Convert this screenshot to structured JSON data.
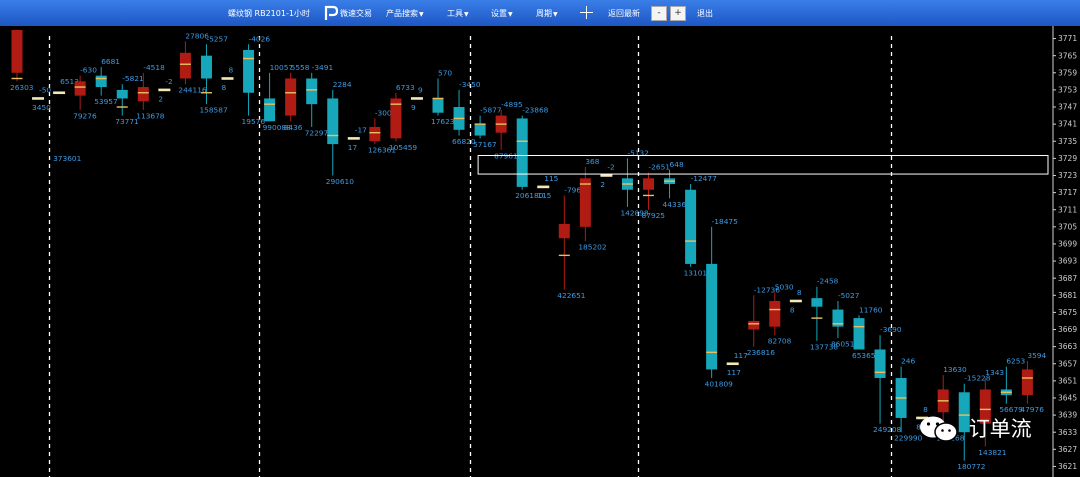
{
  "toolbar": {
    "title": "螺纹钢 RB2101-1小时",
    "brand": "微速交易",
    "menus": [
      {
        "label": "产品搜索",
        "has_caret": true
      },
      {
        "label": "工具",
        "has_caret": true
      },
      {
        "label": "设置",
        "has_caret": true
      },
      {
        "label": "周期",
        "has_caret": true
      }
    ],
    "reset_label": "返回最新",
    "zoom_out": "-",
    "zoom_in": "+",
    "exit_label": "退出"
  },
  "watermark": {
    "text": "订单流"
  },
  "colors": {
    "up": "#b01c14",
    "down": "#16a7bb",
    "doji": "#f2e9b6",
    "label": "#3c9be6",
    "poc": "#e8c060",
    "grid": "#ffffff"
  },
  "chart_data": {
    "type": "candlestick",
    "instrument": "RB2101",
    "period": "1小时",
    "ylim": [
      3618,
      3774
    ],
    "y_ticks": [
      "3771",
      "3765",
      "3759",
      "3753",
      "3747",
      "3741",
      "3735",
      "3729",
      "3723",
      "3717",
      "3711",
      "3705",
      "3699",
      "3693",
      "3687",
      "3681",
      "3675",
      "3669",
      "3663",
      "3657",
      "3651",
      "3645",
      "3639",
      "3633",
      "3627",
      "3621"
    ],
    "session_separators_after_index": [
      1,
      11,
      21,
      29,
      41,
      51,
      59
    ],
    "highlight_band": {
      "from_index": 22,
      "to_index": 63,
      "y_low": 3723.5,
      "y_high": 3730
    },
    "volume_profile_bar": {
      "from_index": 62,
      "y_low": 3646,
      "y_high": 3650
    },
    "candles": [
      {
        "o": 3759,
        "h": 3774,
        "l": 3756,
        "c": 3774,
        "poc": 3757,
        "top": "",
        "bot": "26303"
      },
      {
        "o": 3750,
        "h": 3751,
        "l": 3749,
        "c": 3750,
        "top": "-50",
        "bot": "3450"
      },
      {
        "o": 3752,
        "h": 3754,
        "l": 3731,
        "c": 3752,
        "poc": 3743,
        "top": "6513",
        "bot": "373601"
      },
      {
        "o": 3751,
        "h": 3758,
        "l": 3746,
        "c": 3756,
        "poc": 3754,
        "top": "-630",
        "bot": "79276"
      },
      {
        "o": 3758,
        "h": 3761,
        "l": 3751,
        "c": 3754,
        "poc": 3757,
        "top": "6681",
        "bot": "53957"
      },
      {
        "o": 3753,
        "h": 3755,
        "l": 3744,
        "c": 3750,
        "poc": 3747,
        "top": "-5821",
        "bot": "73771"
      },
      {
        "o": 3749,
        "h": 3759,
        "l": 3746,
        "c": 3754,
        "poc": 3752,
        "top": "-4518",
        "bot": "113678"
      },
      {
        "o": 3753,
        "h": 3754,
        "l": 3752,
        "c": 3753,
        "top": "-2",
        "bot": "2"
      },
      {
        "o": 3757,
        "h": 3770,
        "l": 3755,
        "c": 3766,
        "poc": 3762,
        "top": "27806",
        "bot": "244116"
      },
      {
        "o": 3765,
        "h": 3769,
        "l": 3748,
        "c": 3757,
        "poc": 3752,
        "top": "-5257",
        "bot": "158587"
      },
      {
        "o": 3757,
        "h": 3758,
        "l": 3756,
        "c": 3757,
        "top": "8",
        "bot": "8"
      },
      {
        "o": 3767,
        "h": 3769,
        "l": 3744,
        "c": 3752,
        "poc": 3764,
        "top": "-4026",
        "bot": "19576"
      },
      {
        "o": 3750,
        "h": 3759,
        "l": 3742,
        "c": 3742,
        "poc": 3748,
        "top": "10057",
        "bot": "990088"
      },
      {
        "o": 3744,
        "h": 3759,
        "l": 3742,
        "c": 3757,
        "poc": 3752,
        "top": "5558",
        "bot": "8436"
      },
      {
        "o": 3757,
        "h": 3759,
        "l": 3740,
        "c": 3748,
        "poc": 3753,
        "top": "-3491",
        "bot": "72297"
      },
      {
        "o": 3750,
        "h": 3753,
        "l": 3723,
        "c": 3734,
        "poc": 3737,
        "top": "2284",
        "bot": "290610"
      },
      {
        "o": 3736,
        "h": 3737,
        "l": 3735,
        "c": 3736,
        "top": "-17",
        "bot": "17"
      },
      {
        "o": 3735,
        "h": 3743,
        "l": 3734,
        "c": 3740,
        "poc": 3738,
        "top": "-3005",
        "bot": "126361"
      },
      {
        "o": 3736,
        "h": 3752,
        "l": 3735,
        "c": 3750,
        "poc": 3748,
        "top": "6733",
        "bot": "105459"
      },
      {
        "o": 3750,
        "h": 3751,
        "l": 3749,
        "c": 3750,
        "top": "9",
        "bot": "9"
      },
      {
        "o": 3750,
        "h": 3757,
        "l": 3744,
        "c": 3745,
        "poc": 3750,
        "top": "570",
        "bot": "17623"
      },
      {
        "o": 3747,
        "h": 3753,
        "l": 3737,
        "c": 3739,
        "poc": 3743,
        "top": "-3450",
        "bot": "66820"
      },
      {
        "o": 3741,
        "h": 3744,
        "l": 3736,
        "c": 3737,
        "poc": 3741,
        "top": "-5877",
        "bot": "57167"
      },
      {
        "o": 3738,
        "h": 3746,
        "l": 3732,
        "c": 3744,
        "poc": 3741,
        "top": "-4895",
        "bot": "87961"
      },
      {
        "o": 3743,
        "h": 3744,
        "l": 3718,
        "c": 3719,
        "poc": 3735,
        "top": "-23868",
        "bot": "206180"
      },
      {
        "o": 3719,
        "h": 3720,
        "l": 3718,
        "c": 3719,
        "top": "115",
        "bot": "115"
      },
      {
        "o": 3701,
        "h": 3716,
        "l": 3683,
        "c": 3706,
        "poc": 3695,
        "top": "-7963",
        "bot": "422651"
      },
      {
        "o": 3705,
        "h": 3726,
        "l": 3700,
        "c": 3722,
        "poc": 3720,
        "top": "368",
        "bot": "185202"
      },
      {
        "o": 3723,
        "h": 3724,
        "l": 3722,
        "c": 3723,
        "top": "-2",
        "bot": "2"
      },
      {
        "o": 3722,
        "h": 3729,
        "l": 3712,
        "c": 3718,
        "poc": 3720,
        "top": "-5132",
        "bot": "142898"
      },
      {
        "o": 3718,
        "h": 3724,
        "l": 3711,
        "c": 3722,
        "poc": 3716,
        "top": "-2651",
        "bot": "87925"
      },
      {
        "o": 3722,
        "h": 3725,
        "l": 3715,
        "c": 3720,
        "poc": 3721,
        "top": "648",
        "bot": "44336"
      },
      {
        "o": 3718,
        "h": 3720,
        "l": 3691,
        "c": 3692,
        "poc": 3700,
        "top": "-12477",
        "bot": "131013"
      },
      {
        "o": 3692,
        "h": 3705,
        "l": 3652,
        "c": 3655,
        "poc": 3661,
        "top": "-18475",
        "bot": "401809"
      },
      {
        "o": 3657,
        "h": 3658,
        "l": 3656,
        "c": 3657,
        "top": "117",
        "bot": "117"
      },
      {
        "o": 3669,
        "h": 3681,
        "l": 3663,
        "c": 3672,
        "poc": 3671,
        "top": "-12736",
        "bot": "236816"
      },
      {
        "o": 3670,
        "h": 3682,
        "l": 3667,
        "c": 3679,
        "poc": 3676,
        "top": "5030",
        "bot": "82708"
      },
      {
        "o": 3679,
        "h": 3680,
        "l": 3678,
        "c": 3679,
        "top": "8",
        "bot": "8"
      },
      {
        "o": 3680,
        "h": 3684,
        "l": 3665,
        "c": 3677,
        "poc": 3673,
        "top": "-2458",
        "bot": "137738"
      },
      {
        "o": 3676,
        "h": 3679,
        "l": 3666,
        "c": 3670,
        "poc": 3671,
        "top": "-5027",
        "bot": "86051"
      },
      {
        "o": 3673,
        "h": 3674,
        "l": 3662,
        "c": 3662,
        "poc": 3670,
        "top": "11760",
        "bot": "65365"
      },
      {
        "o": 3662,
        "h": 3667,
        "l": 3636,
        "c": 3652,
        "poc": 3654,
        "top": "-3690",
        "bot": "249208"
      },
      {
        "o": 3652,
        "h": 3656,
        "l": 3633,
        "c": 3638,
        "poc": 3645,
        "top": "246",
        "bot": "229990"
      },
      {
        "o": 3638,
        "h": 3639,
        "l": 3637,
        "c": 3638,
        "top": "8",
        "bot": "8"
      },
      {
        "o": 3640,
        "h": 3653,
        "l": 3633,
        "c": 3648,
        "poc": 3644,
        "top": "13630",
        "bot": "196168"
      },
      {
        "o": 3647,
        "h": 3650,
        "l": 3623,
        "c": 3633,
        "poc": 3639,
        "top": "-15228",
        "bot": "180772"
      },
      {
        "o": 3636,
        "h": 3652,
        "l": 3628,
        "c": 3648,
        "poc": 3641,
        "top": "1343",
        "bot": "143821"
      },
      {
        "o": 3648,
        "h": 3656,
        "l": 3643,
        "c": 3646,
        "poc": 3647,
        "top": "6253",
        "bot": "56679"
      },
      {
        "o": 3646,
        "h": 3658,
        "l": 3643,
        "c": 3655,
        "poc": 3652,
        "top": "3594",
        "bot": "47976"
      }
    ]
  }
}
